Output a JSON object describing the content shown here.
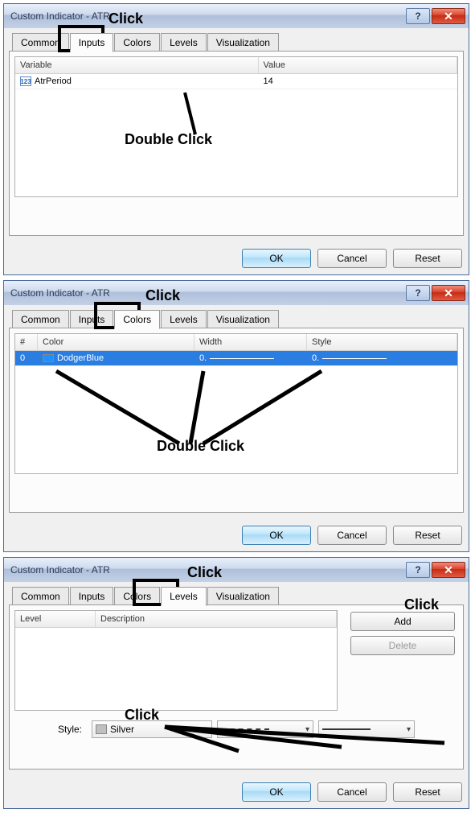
{
  "dialogs": [
    {
      "title": "Custom Indicator - ATR",
      "tabs": [
        "Common",
        "Inputs",
        "Colors",
        "Levels",
        "Visualization"
      ],
      "active_tab": "Inputs",
      "inputs_table": {
        "headers": [
          "Variable",
          "Value"
        ],
        "rows": [
          {
            "icon": "123",
            "variable": "AtrPeriod",
            "value": "14"
          }
        ]
      },
      "buttons": {
        "ok": "OK",
        "cancel": "Cancel",
        "reset": "Reset"
      },
      "annotations": {
        "click_label": "Click",
        "dbl_label": "Double Click"
      }
    },
    {
      "title": "Custom Indicator - ATR",
      "tabs": [
        "Common",
        "Inputs",
        "Colors",
        "Levels",
        "Visualization"
      ],
      "active_tab": "Colors",
      "colors_table": {
        "headers": [
          "#",
          "Color",
          "Width",
          "Style"
        ],
        "rows": [
          {
            "num": "0",
            "color_name": "DodgerBlue",
            "width": "0.",
            "style": "0."
          }
        ]
      },
      "buttons": {
        "ok": "OK",
        "cancel": "Cancel",
        "reset": "Reset"
      },
      "annotations": {
        "click_label": "Click",
        "dbl_label": "Double Click"
      }
    },
    {
      "title": "Custom Indicator - ATR",
      "tabs": [
        "Common",
        "Inputs",
        "Colors",
        "Levels",
        "Visualization"
      ],
      "active_tab": "Levels",
      "levels_table": {
        "headers": [
          "Level",
          "Description"
        ]
      },
      "side_buttons": {
        "add": "Add",
        "delete": "Delete"
      },
      "style_section": {
        "label": "Style:",
        "color": "Silver"
      },
      "buttons": {
        "ok": "OK",
        "cancel": "Cancel",
        "reset": "Reset"
      },
      "annotations": {
        "click_label": "Click",
        "click_label_2": "Click",
        "click_label_3": "Click"
      }
    }
  ]
}
